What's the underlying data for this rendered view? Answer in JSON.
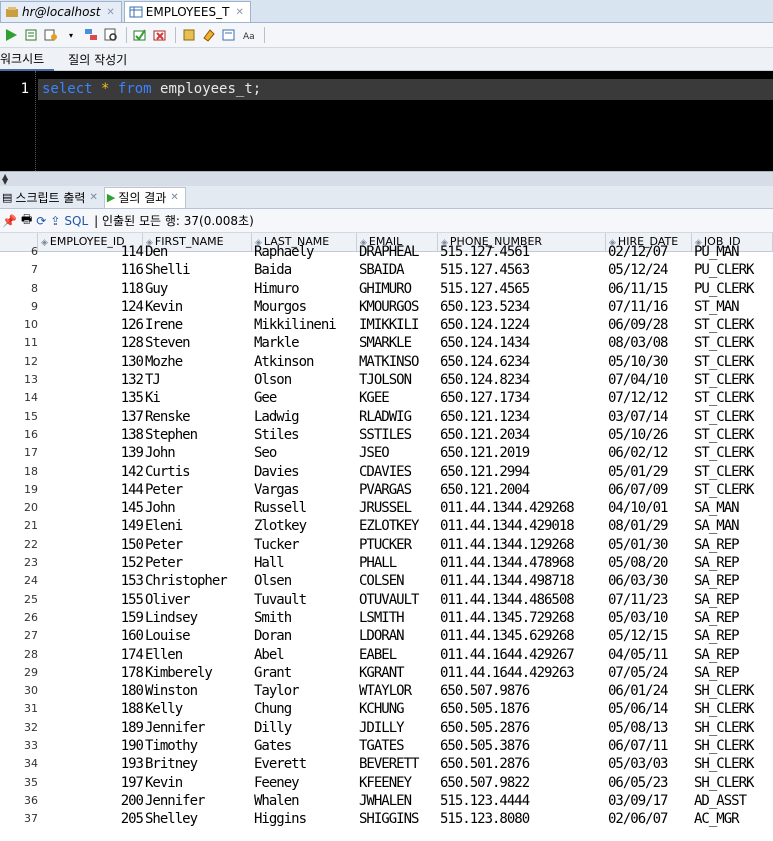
{
  "doc_tabs": [
    {
      "label": "hr@localhost",
      "active": false
    },
    {
      "label": "EMPLOYEES_T",
      "active": true
    }
  ],
  "worksheet_tabs": [
    "워크시트",
    "질의 작성기"
  ],
  "editor": {
    "line_number": "1",
    "code": {
      "kw1": "select",
      "star": "*",
      "kw2": "from",
      "table": "employees_t;"
    }
  },
  "result_tabs": [
    {
      "label": "스크립트 출력",
      "active": false
    },
    {
      "label": "질의 결과",
      "active": true
    }
  ],
  "result_toolbar": {
    "sql_label": "SQL",
    "status": "| 인출된 모든 행: 37(0.008초)"
  },
  "columns": [
    "EMPLOYEE_ID",
    "FIRST_NAME",
    "LAST_NAME",
    "EMAIL",
    "PHONE_NUMBER",
    "HIRE_DATE",
    "JOB_ID"
  ],
  "rows": [
    [
      "6",
      "114",
      "Den",
      "Raphaely",
      "DRAPHEAL",
      "515.127.4561",
      "02/12/07",
      "PU_MAN"
    ],
    [
      "7",
      "116",
      "Shelli",
      "Baida",
      "SBAIDA",
      "515.127.4563",
      "05/12/24",
      "PU_CLERK"
    ],
    [
      "8",
      "118",
      "Guy",
      "Himuro",
      "GHIMURO",
      "515.127.4565",
      "06/11/15",
      "PU_CLERK"
    ],
    [
      "9",
      "124",
      "Kevin",
      "Mourgos",
      "KMOURGOS",
      "650.123.5234",
      "07/11/16",
      "ST_MAN"
    ],
    [
      "10",
      "126",
      "Irene",
      "Mikkilineni",
      "IMIKKILI",
      "650.124.1224",
      "06/09/28",
      "ST_CLERK"
    ],
    [
      "11",
      "128",
      "Steven",
      "Markle",
      "SMARKLE",
      "650.124.1434",
      "08/03/08",
      "ST_CLERK"
    ],
    [
      "12",
      "130",
      "Mozhe",
      "Atkinson",
      "MATKINSO",
      "650.124.6234",
      "05/10/30",
      "ST_CLERK"
    ],
    [
      "13",
      "132",
      "TJ",
      "Olson",
      "TJOLSON",
      "650.124.8234",
      "07/04/10",
      "ST_CLERK"
    ],
    [
      "14",
      "135",
      "Ki",
      "Gee",
      "KGEE",
      "650.127.1734",
      "07/12/12",
      "ST_CLERK"
    ],
    [
      "15",
      "137",
      "Renske",
      "Ladwig",
      "RLADWIG",
      "650.121.1234",
      "03/07/14",
      "ST_CLERK"
    ],
    [
      "16",
      "138",
      "Stephen",
      "Stiles",
      "SSTILES",
      "650.121.2034",
      "05/10/26",
      "ST_CLERK"
    ],
    [
      "17",
      "139",
      "John",
      "Seo",
      "JSEO",
      "650.121.2019",
      "06/02/12",
      "ST_CLERK"
    ],
    [
      "18",
      "142",
      "Curtis",
      "Davies",
      "CDAVIES",
      "650.121.2994",
      "05/01/29",
      "ST_CLERK"
    ],
    [
      "19",
      "144",
      "Peter",
      "Vargas",
      "PVARGAS",
      "650.121.2004",
      "06/07/09",
      "ST_CLERK"
    ],
    [
      "20",
      "145",
      "John",
      "Russell",
      "JRUSSEL",
      "011.44.1344.429268",
      "04/10/01",
      "SA_MAN"
    ],
    [
      "21",
      "149",
      "Eleni",
      "Zlotkey",
      "EZLOTKEY",
      "011.44.1344.429018",
      "08/01/29",
      "SA_MAN"
    ],
    [
      "22",
      "150",
      "Peter",
      "Tucker",
      "PTUCKER",
      "011.44.1344.129268",
      "05/01/30",
      "SA_REP"
    ],
    [
      "23",
      "152",
      "Peter",
      "Hall",
      "PHALL",
      "011.44.1344.478968",
      "05/08/20",
      "SA_REP"
    ],
    [
      "24",
      "153",
      "Christopher",
      "Olsen",
      "COLSEN",
      "011.44.1344.498718",
      "06/03/30",
      "SA_REP"
    ],
    [
      "25",
      "155",
      "Oliver",
      "Tuvault",
      "OTUVAULT",
      "011.44.1344.486508",
      "07/11/23",
      "SA_REP"
    ],
    [
      "26",
      "159",
      "Lindsey",
      "Smith",
      "LSMITH",
      "011.44.1345.729268",
      "05/03/10",
      "SA_REP"
    ],
    [
      "27",
      "160",
      "Louise",
      "Doran",
      "LDORAN",
      "011.44.1345.629268",
      "05/12/15",
      "SA_REP"
    ],
    [
      "28",
      "174",
      "Ellen",
      "Abel",
      "EABEL",
      "011.44.1644.429267",
      "04/05/11",
      "SA_REP"
    ],
    [
      "29",
      "178",
      "Kimberely",
      "Grant",
      "KGRANT",
      "011.44.1644.429263",
      "07/05/24",
      "SA_REP"
    ],
    [
      "30",
      "180",
      "Winston",
      "Taylor",
      "WTAYLOR",
      "650.507.9876",
      "06/01/24",
      "SH_CLERK"
    ],
    [
      "31",
      "188",
      "Kelly",
      "Chung",
      "KCHUNG",
      "650.505.1876",
      "05/06/14",
      "SH_CLERK"
    ],
    [
      "32",
      "189",
      "Jennifer",
      "Dilly",
      "JDILLY",
      "650.505.2876",
      "05/08/13",
      "SH_CLERK"
    ],
    [
      "33",
      "190",
      "Timothy",
      "Gates",
      "TGATES",
      "650.505.3876",
      "06/07/11",
      "SH_CLERK"
    ],
    [
      "34",
      "193",
      "Britney",
      "Everett",
      "BEVERETT",
      "650.501.2876",
      "05/03/03",
      "SH_CLERK"
    ],
    [
      "35",
      "197",
      "Kevin",
      "Feeney",
      "KFEENEY",
      "650.507.9822",
      "06/05/23",
      "SH_CLERK"
    ],
    [
      "36",
      "200",
      "Jennifer",
      "Whalen",
      "JWHALEN",
      "515.123.4444",
      "03/09/17",
      "AD_ASST"
    ],
    [
      "37",
      "205",
      "Shelley",
      "Higgins",
      "SHIGGINS",
      "515.123.8080",
      "02/06/07",
      "AC_MGR"
    ]
  ],
  "colors": {
    "editor_bg": "#000000",
    "keyword": "#3b82ff",
    "selected_line": "#3a3a3a"
  }
}
